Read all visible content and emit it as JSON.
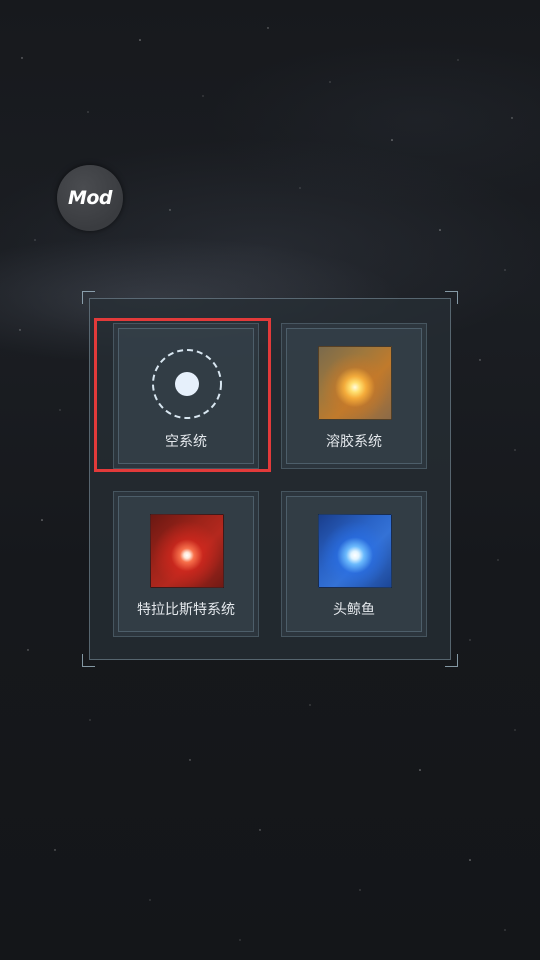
{
  "mod_button": {
    "label": "Mod",
    "icon": "mod-icon"
  },
  "panel": {
    "slots": [
      {
        "label": "空系统",
        "icon": "empty-system-icon",
        "selected": true
      },
      {
        "label": "溶胶系统",
        "icon": "nebula-thumbnail-icon",
        "selected": false
      },
      {
        "label": "特拉比斯特系统",
        "icon": "red-star-thumbnail-icon",
        "selected": false
      },
      {
        "label": "头鲸鱼",
        "icon": "blue-star-thumbnail-icon",
        "selected": false
      }
    ]
  },
  "colors": {
    "selection_highlight": "#e23a3a",
    "panel_bg": "#262e34",
    "label_text": "#e4e8ec"
  }
}
